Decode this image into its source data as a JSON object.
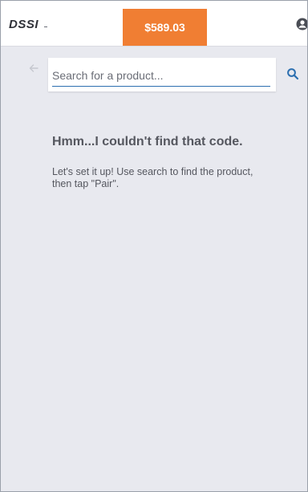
{
  "header": {
    "logo_text": "DSSI",
    "balance_label": "$589.03",
    "account_icon": "account-icon"
  },
  "search": {
    "back_icon": "arrow-left-icon",
    "placeholder": "Search for a product...",
    "value": "",
    "search_icon": "search-icon"
  },
  "empty_state": {
    "title": "Hmm...I couldn't find that code.",
    "message": "Let's set it up! Use search to find the product, then tap \"Pair\"."
  },
  "colors": {
    "accent": "#f07e33",
    "link_blue": "#2c6fb0",
    "background": "#e8e9ef",
    "text": "#55575f"
  }
}
